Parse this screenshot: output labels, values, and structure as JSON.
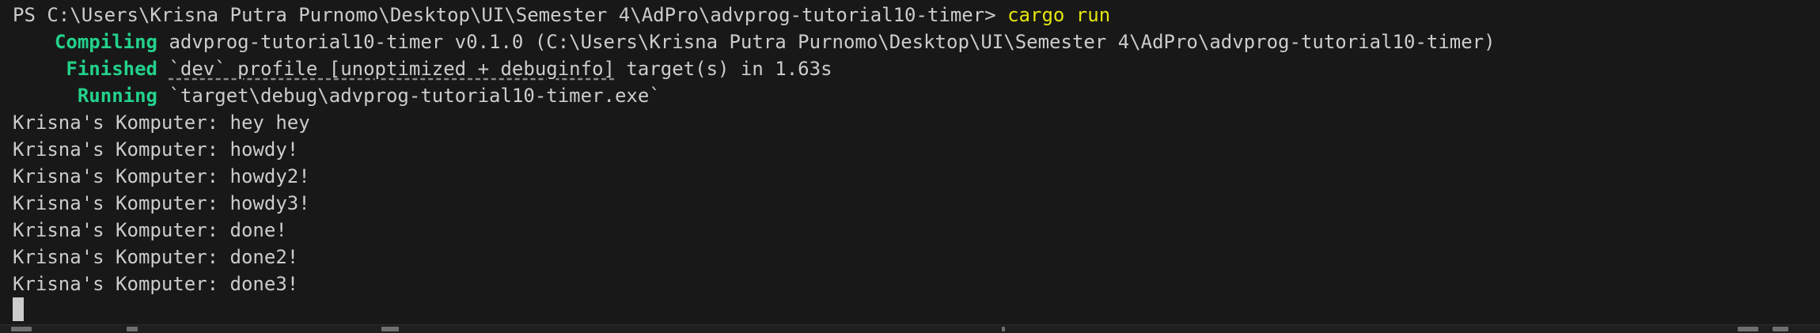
{
  "terminal": {
    "prompt": "PS C:\\Users\\Krisna Putra Purnomo\\Desktop\\UI\\Semester 4\\AdPro\\advprog-tutorial10-timer> ",
    "command": "cargo run",
    "build": {
      "compiling_label": "Compiling",
      "compiling_text": " advprog-tutorial10-timer v0.1.0 (C:\\Users\\Krisna Putra Purnomo\\Desktop\\UI\\Semester 4\\AdPro\\advprog-tutorial10-timer)",
      "finished_label": "Finished",
      "finished_pre": " ",
      "finished_profile": "`dev` profile [unoptimized + debuginfo]",
      "finished_post": " target(s) in 1.63s",
      "running_label": "Running",
      "running_text": " `target\\debug\\advprog-tutorial10-timer.exe`"
    },
    "output": [
      "Krisna's Komputer: hey hey",
      "Krisna's Komputer: howdy!",
      "Krisna's Komputer: howdy2!",
      "Krisna's Komputer: howdy3!",
      "Krisna's Komputer: done!",
      "Krisna's Komputer: done2!",
      "Krisna's Komputer: done3!"
    ]
  },
  "colors": {
    "background": "#181818",
    "foreground": "#cccccc",
    "command": "#e5e510",
    "status": "#23d18b"
  }
}
